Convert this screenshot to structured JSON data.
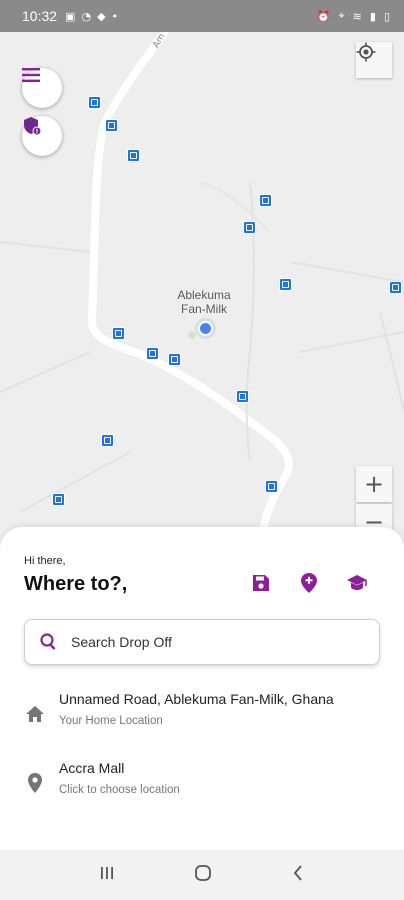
{
  "status_bar": {
    "time": "10:32",
    "left_icons": [
      "gallery-icon",
      "snapchat-icon",
      "notification-icon",
      "dot-icon"
    ],
    "right_icons": [
      "alarm-icon",
      "location-icon",
      "wifi-icon",
      "signal-icon",
      "battery-icon"
    ]
  },
  "map": {
    "place_label_line1": "Ablekuma",
    "place_label_line2": "Fan-Milk",
    "road_label": "Am",
    "zoom_in_label": "+",
    "zoom_out_label": "−"
  },
  "sheet": {
    "greeting": "Hi there,",
    "title": "Where to?,",
    "search_placeholder": "Search Drop Off",
    "locations": [
      {
        "title": "Unnamed Road, Ablekuma Fan-Milk, Ghana",
        "subtitle": "Your Home Location",
        "icon": "home-icon"
      },
      {
        "title": "Accra Mall",
        "subtitle": "Click to choose location",
        "icon": "location-pin-icon"
      }
    ]
  },
  "colors": {
    "accent": "#8e1f9b",
    "map_bg": "#eeeeee",
    "bus_stop": "#1e73e8",
    "user_dot": "#4a84ea"
  }
}
